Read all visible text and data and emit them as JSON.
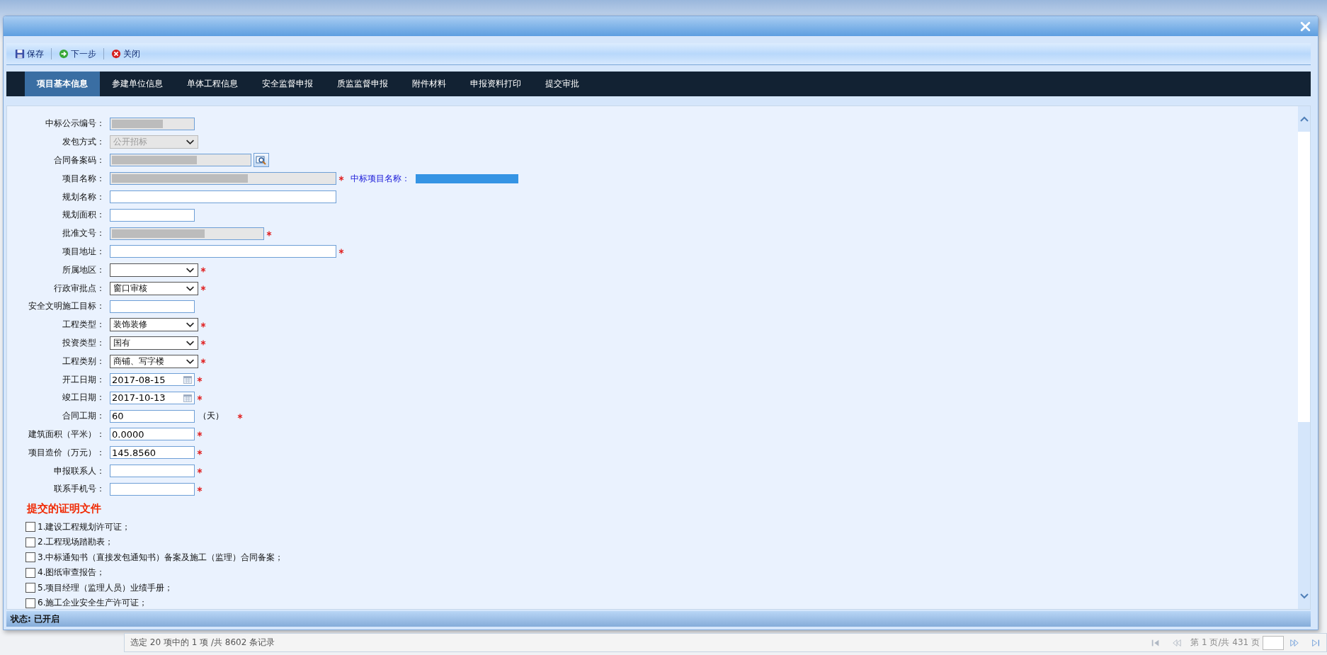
{
  "toolbar": [
    {
      "label": "保存"
    },
    {
      "label": "下一步"
    },
    {
      "label": "关闭"
    }
  ],
  "tabs": [
    {
      "label": "项目基本信息",
      "selected": true
    },
    {
      "label": "参建单位信息",
      "selected": false
    },
    {
      "label": "单体工程信息",
      "selected": false
    },
    {
      "label": "安全监督申报",
      "selected": false
    },
    {
      "label": "质监监督申报",
      "selected": false
    },
    {
      "label": "附件材料",
      "selected": false
    },
    {
      "label": "申报资料打印",
      "selected": false
    },
    {
      "label": "提交审批",
      "selected": false
    }
  ],
  "form": {
    "fields": [
      {
        "label": "中标公示编号：",
        "kind": "text",
        "readonly": true,
        "redacted": true,
        "required": false
      },
      {
        "label": "发包方式：",
        "kind": "select",
        "readonly": true,
        "redacted": false,
        "required": false,
        "value": "公开招标"
      },
      {
        "label": "合同备案码：",
        "kind": "text",
        "readonly": true,
        "redacted": true,
        "required": false,
        "lookup_button": true
      },
      {
        "label": "项目名称：",
        "kind": "text",
        "readonly": true,
        "redacted": true,
        "required": true,
        "note_label": "中标项目名称：",
        "note_redacted": true
      },
      {
        "label": "规划名称：",
        "kind": "text",
        "readonly": false,
        "redacted": false,
        "required": false
      },
      {
        "label": "规划面积：",
        "kind": "text",
        "readonly": false,
        "redacted": false,
        "required": false
      },
      {
        "label": "批准文号：",
        "kind": "text",
        "readonly": true,
        "redacted": true,
        "required": true
      },
      {
        "label": "项目地址：",
        "kind": "text",
        "readonly": false,
        "redacted": false,
        "required": true
      },
      {
        "label": "所属地区：",
        "kind": "select",
        "readonly": false,
        "redacted": false,
        "required": true
      },
      {
        "label": "行政审批点：",
        "kind": "select",
        "readonly": false,
        "redacted": false,
        "required": true,
        "value": "窗口审核"
      },
      {
        "label": "安全文明施工目标：",
        "kind": "text",
        "readonly": false,
        "redacted": false,
        "required": false
      },
      {
        "label": "工程类型：",
        "kind": "select",
        "readonly": false,
        "redacted": false,
        "required": true,
        "value": "装饰装修"
      },
      {
        "label": "投资类型：",
        "kind": "select",
        "readonly": false,
        "redacted": false,
        "required": true,
        "value": "国有"
      },
      {
        "label": "工程类别：",
        "kind": "select",
        "readonly": false,
        "redacted": false,
        "required": true,
        "value": "商铺、写字楼"
      },
      {
        "label": "开工日期：",
        "kind": "date",
        "readonly": false,
        "redacted": false,
        "required": true,
        "value": "2017-08-15"
      },
      {
        "label": "竣工日期：",
        "kind": "date",
        "readonly": false,
        "redacted": false,
        "required": true,
        "value": "2017-10-13"
      },
      {
        "label": "合同工期：",
        "kind": "text",
        "readonly": false,
        "redacted": false,
        "required": true,
        "value": "60",
        "suffix": "（天）"
      },
      {
        "label": "建筑面积（平米）：",
        "kind": "text",
        "readonly": false,
        "redacted": false,
        "required": true,
        "value": "0.0000"
      },
      {
        "label": "项目造价（万元）：",
        "kind": "text",
        "readonly": false,
        "redacted": false,
        "required": true,
        "value": "145.8560"
      },
      {
        "label": "申报联系人：",
        "kind": "text",
        "readonly": false,
        "redacted": false,
        "required": true
      },
      {
        "label": "联系手机号：",
        "kind": "text",
        "readonly": false,
        "redacted": false,
        "required": true
      }
    ],
    "section_title": "提交的证明文件",
    "documents": [
      {
        "label": "1.建设工程规划许可证；",
        "checked": false
      },
      {
        "label": "2.工程现场踏勘表；",
        "checked": false
      },
      {
        "label": "3.中标通知书（直接发包通知书）备案及施工（监理）合同备案；",
        "checked": false
      },
      {
        "label": "4.图纸审查报告；",
        "checked": false
      },
      {
        "label": "5.项目经理（监理人员）业绩手册；",
        "checked": false
      },
      {
        "label": "6.施工企业安全生产许可证；",
        "checked": false
      }
    ]
  },
  "status_bar": {
    "text": "状态: 已开启"
  },
  "pager": {
    "summary": "选定 20 项中的 1 项 /共 8602 条记录",
    "page_info": "第 1 页/共 431 页"
  }
}
